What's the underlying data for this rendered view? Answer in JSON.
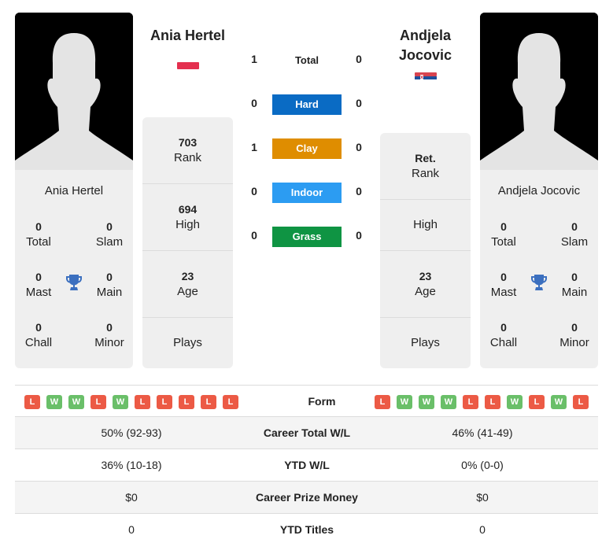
{
  "player1": {
    "name": "Ania Hertel",
    "header_name": "Ania Hertel",
    "flag": "poland-flag",
    "titles": {
      "total": {
        "value": "0",
        "label": "Total"
      },
      "slam": {
        "value": "0",
        "label": "Slam"
      },
      "mast": {
        "value": "0",
        "label": "Mast"
      },
      "main": {
        "value": "0",
        "label": "Main"
      },
      "chall": {
        "value": "0",
        "label": "Chall"
      },
      "minor": {
        "value": "0",
        "label": "Minor"
      }
    },
    "stats": [
      {
        "value": "703",
        "label": "Rank"
      },
      {
        "value": "694",
        "label": "High"
      },
      {
        "value": "23",
        "label": "Age"
      },
      {
        "value": "",
        "label": "Plays"
      }
    ],
    "form": [
      "L",
      "W",
      "W",
      "L",
      "W",
      "L",
      "L",
      "L",
      "L",
      "L"
    ]
  },
  "player2": {
    "name": "Andjela Jocovic",
    "header_name_line1": "Andjela",
    "header_name_line2": "Jocovic",
    "flag": "serbia-flag",
    "titles": {
      "total": {
        "value": "0",
        "label": "Total"
      },
      "slam": {
        "value": "0",
        "label": "Slam"
      },
      "mast": {
        "value": "0",
        "label": "Mast"
      },
      "main": {
        "value": "0",
        "label": "Main"
      },
      "chall": {
        "value": "0",
        "label": "Chall"
      },
      "minor": {
        "value": "0",
        "label": "Minor"
      }
    },
    "stats": [
      {
        "value": "Ret.",
        "label": "Rank"
      },
      {
        "value": "",
        "label": "High"
      },
      {
        "value": "23",
        "label": "Age"
      },
      {
        "value": "",
        "label": "Plays"
      }
    ],
    "form": [
      "L",
      "W",
      "W",
      "W",
      "L",
      "L",
      "W",
      "L",
      "W",
      "L"
    ]
  },
  "h2h": [
    {
      "label": "Total",
      "p1": "1",
      "p2": "0",
      "color": null
    },
    {
      "label": "Hard",
      "p1": "0",
      "p2": "0",
      "color": "#0a6bc4"
    },
    {
      "label": "Clay",
      "p1": "1",
      "p2": "0",
      "color": "#df8d00"
    },
    {
      "label": "Indoor",
      "p1": "0",
      "p2": "0",
      "color": "#2c9cf2"
    },
    {
      "label": "Grass",
      "p1": "0",
      "p2": "0",
      "color": "#0f9443"
    }
  ],
  "form_label": "Form",
  "comparison": [
    {
      "label": "Career Total W/L",
      "p1": "50% (92-93)",
      "p2": "46% (41-49)"
    },
    {
      "label": "YTD W/L",
      "p1": "36% (10-18)",
      "p2": "0% (0-0)"
    },
    {
      "label": "Career Prize Money",
      "p1": "$0",
      "p2": "$0"
    },
    {
      "label": "YTD Titles",
      "p1": "0",
      "p2": "0"
    }
  ],
  "colors": {
    "win": "#6abf69",
    "loss": "#ec5a45",
    "trophy": "#3b6fbf"
  }
}
